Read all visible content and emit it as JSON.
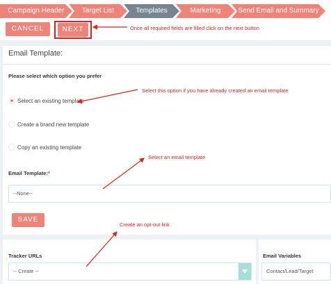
{
  "wizard": {
    "steps": [
      {
        "label": "Campaign Header",
        "active": false
      },
      {
        "label": "Target List",
        "active": false
      },
      {
        "label": "Templates",
        "active": true
      },
      {
        "label": "Marketing",
        "active": false
      },
      {
        "label": "Send Email and Summary",
        "active": false
      }
    ]
  },
  "actions": {
    "cancel_label": "CANCEL",
    "next_label": "NEXT"
  },
  "annotations": {
    "next_hint": "Once all required fields are filled click on the next button",
    "existing_hint": "Select this option if you have already created an email template",
    "select_template_hint": "Select an email template",
    "optout_hint": "Create an opt-out  link"
  },
  "email_template_panel": {
    "title": "Email Template:",
    "prompt": "Please select which option you prefer",
    "options": [
      {
        "label": "Select an existing template",
        "checked": true
      },
      {
        "label": "Create a brand new template",
        "checked": false
      },
      {
        "label": "Copy an existing template",
        "checked": false
      }
    ],
    "field_label": "Email Template:",
    "required_mark": "*",
    "selected_value": "--None--",
    "save_label": "SAVE"
  },
  "tracker_panel": {
    "title": "Tracker URLs",
    "selected_value": "-- Create --"
  },
  "variables_panel": {
    "title": "Email Variables",
    "selected_value": "Contact/Lead/Target"
  },
  "colors": {
    "accent": "#f08377",
    "active_step": "#778591",
    "annotation": "#e0201b",
    "caret": "#a6dfd8"
  }
}
